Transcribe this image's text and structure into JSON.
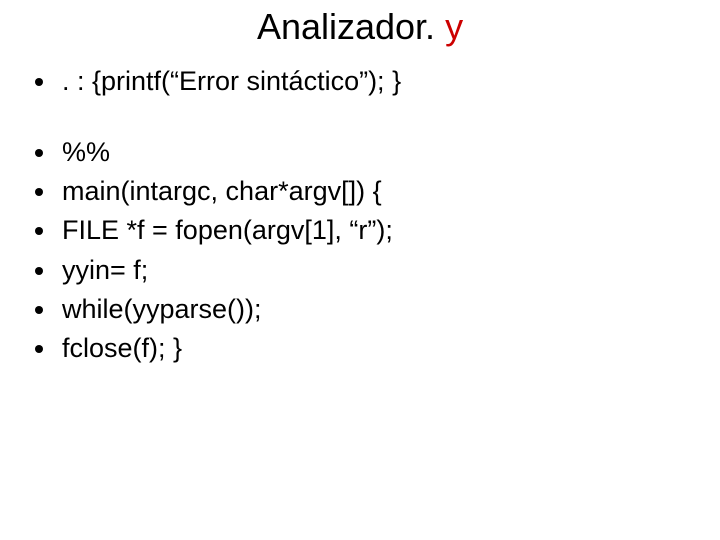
{
  "title": {
    "prefix": "Analizador. ",
    "highlight": "y"
  },
  "bullets": {
    "b1": ". : {printf(“Error sintáctico”); }",
    "b2": "%%",
    "b3": "main(intargc, char*argv[]) {",
    "b4": "FILE *f = fopen(argv[1], “r”);",
    "b5": "yyin= f;",
    "b6": "while(yyparse());",
    "b7": "fclose(f); }"
  }
}
